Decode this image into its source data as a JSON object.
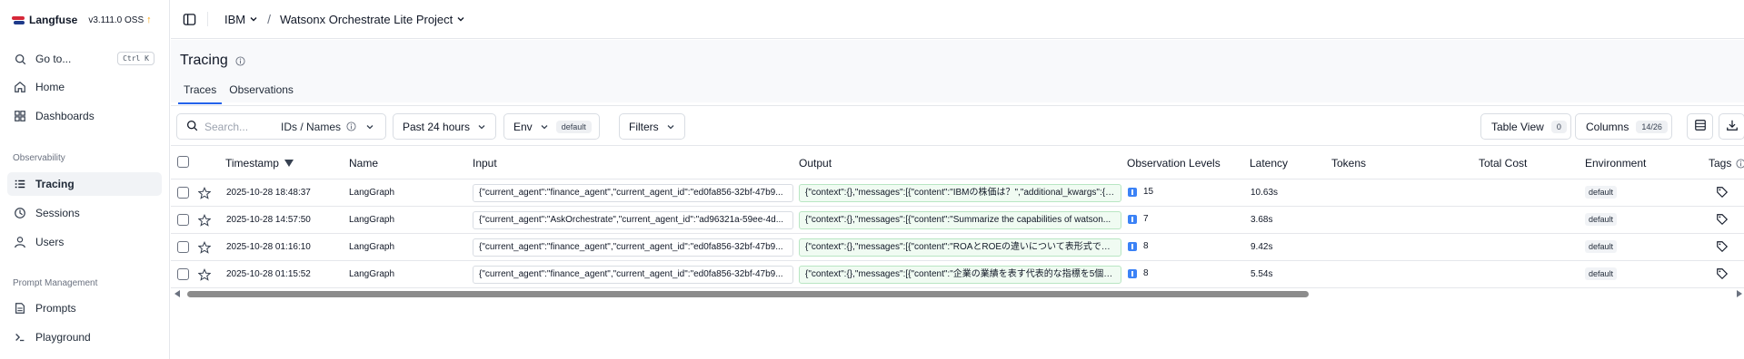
{
  "brand": {
    "name": "Langfuse",
    "version": "v3.111.0 OSS",
    "update_icon": "arrow-up-icon"
  },
  "sidebar": {
    "goto": {
      "label": "Go to...",
      "shortcut": "Ctrl K"
    },
    "top_items": [
      {
        "label": "Home",
        "icon": "home-icon"
      },
      {
        "label": "Dashboards",
        "icon": "dashboard-icon"
      }
    ],
    "section_observability": "Observability",
    "obs_items": [
      {
        "label": "Tracing",
        "icon": "list-icon",
        "active": true
      },
      {
        "label": "Sessions",
        "icon": "clock-icon"
      },
      {
        "label": "Users",
        "icon": "users-icon"
      }
    ],
    "section_prompt": "Prompt Management",
    "prompt_items": [
      {
        "label": "Prompts",
        "icon": "file-icon"
      },
      {
        "label": "Playground",
        "icon": "terminal-icon"
      }
    ]
  },
  "breadcrumb": {
    "org": "IBM",
    "project": "Watsonx Orchestrate Lite Project"
  },
  "page": {
    "title": "Tracing",
    "tabs": [
      {
        "label": "Traces",
        "active": true
      },
      {
        "label": "Observations"
      }
    ]
  },
  "toolbar": {
    "search_placeholder": "Search...",
    "search_mode": "IDs / Names",
    "time_range": "Past 24 hours",
    "env_label": "Env",
    "env_value": "default",
    "filters_label": "Filters",
    "table_view_label": "Table View",
    "table_view_count": "0",
    "columns_label": "Columns",
    "columns_count": "14/26"
  },
  "table": {
    "headers": {
      "timestamp": "Timestamp",
      "name": "Name",
      "input": "Input",
      "output": "Output",
      "observation_levels": "Observation Levels",
      "latency": "Latency",
      "tokens": "Tokens",
      "total_cost": "Total Cost",
      "environment": "Environment",
      "tags": "Tags"
    },
    "rows": [
      {
        "timestamp": "2025-10-28 18:48:37",
        "name": "LangGraph",
        "input": "{\"current_agent\":\"finance_agent\",\"current_agent_id\":\"ed0fa856-32bf-47b9...",
        "output": "{\"context\":{},\"messages\":[{\"content\":\"IBMの株価は？\",\"additional_kwargs\":{}...",
        "levels": "15",
        "latency": "10.63s",
        "environment": "default"
      },
      {
        "timestamp": "2025-10-28 14:57:50",
        "name": "LangGraph",
        "input": "{\"current_agent\":\"AskOrchestrate\",\"current_agent_id\":\"ad96321a-59ee-4d...",
        "output": "{\"context\":{},\"messages\":[{\"content\":\"Summarize the capabilities of watson...",
        "levels": "7",
        "latency": "3.68s",
        "environment": "default"
      },
      {
        "timestamp": "2025-10-28 01:16:10",
        "name": "LangGraph",
        "input": "{\"current_agent\":\"finance_agent\",\"current_agent_id\":\"ed0fa856-32bf-47b9...",
        "output": "{\"context\":{},\"messages\":[{\"content\":\"ROAとROEの違いについて表形式で整理...",
        "levels": "8",
        "latency": "9.42s",
        "environment": "default"
      },
      {
        "timestamp": "2025-10-28 01:15:52",
        "name": "LangGraph",
        "input": "{\"current_agent\":\"finance_agent\",\"current_agent_id\":\"ed0fa856-32bf-47b9...",
        "output": "{\"context\":{},\"messages\":[{\"content\":\"企業の業績を表す代表的な指標を5個リ...",
        "levels": "8",
        "latency": "5.54s",
        "environment": "default"
      }
    ]
  },
  "colors": {
    "accent": "#2563eb",
    "brand_red": "#d62839",
    "update_arrow": "#f59e0b",
    "output_bg": "#f0fbf2",
    "level_info": "#3b82f6"
  }
}
